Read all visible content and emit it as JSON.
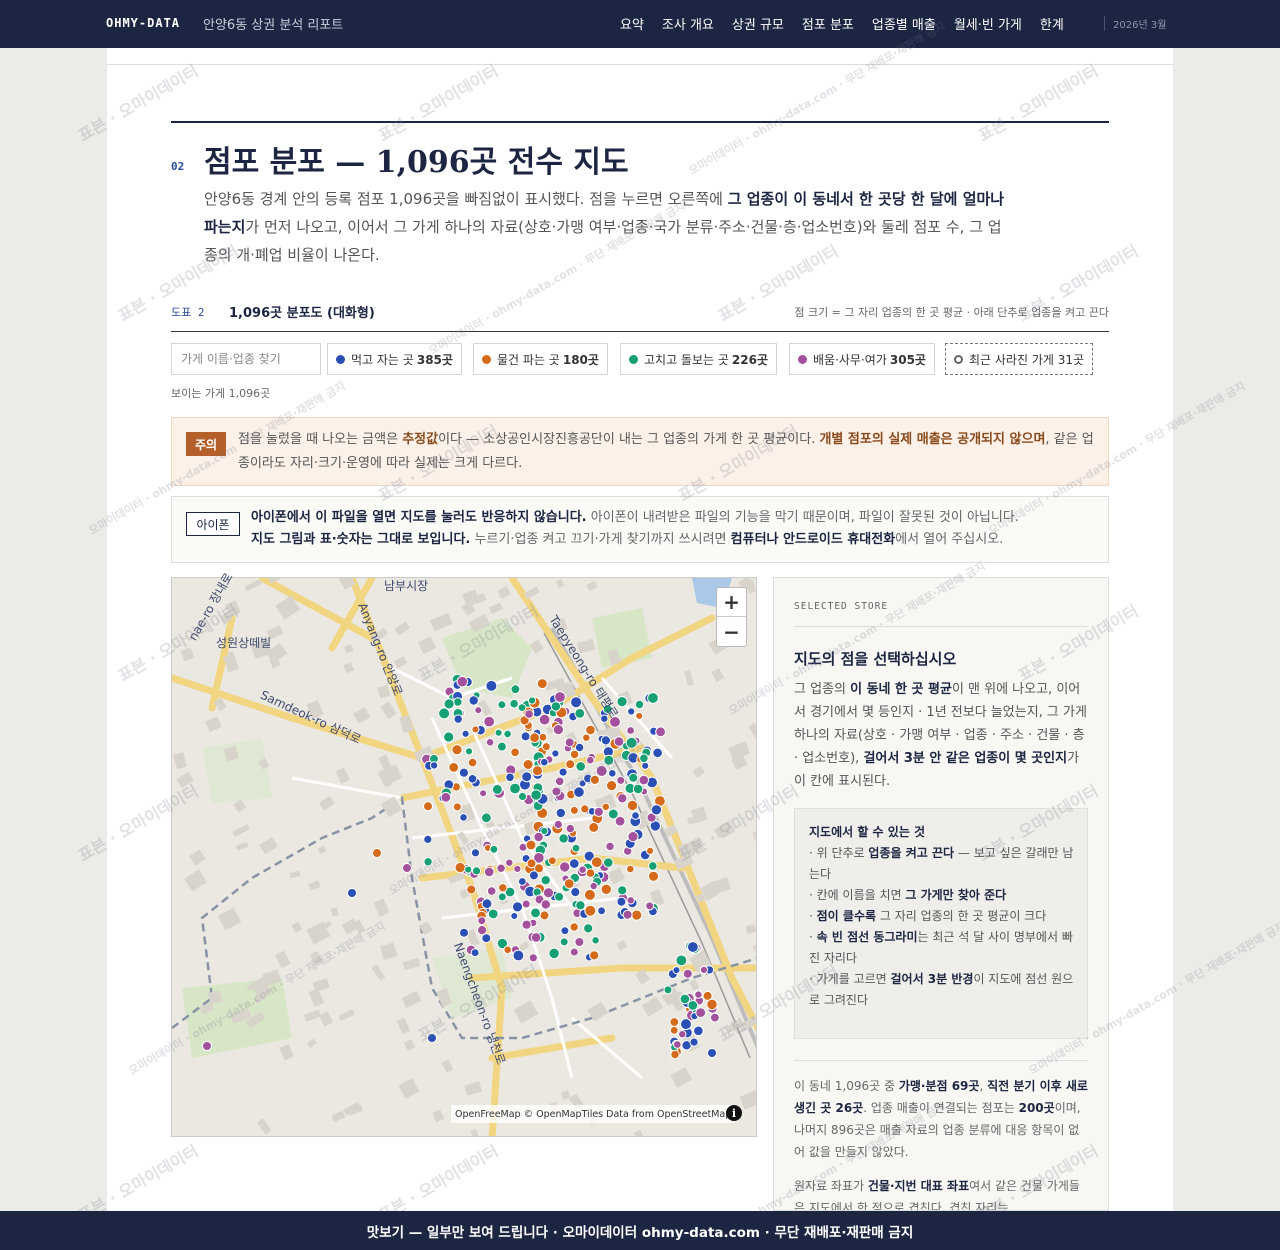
{
  "nav": {
    "brand": "OHMY-DATA",
    "subtitle": "안양6동 상권 분석 리포트",
    "links": [
      "요약",
      "조사 개요",
      "상권 규모",
      "점포 분포",
      "업종별 매출",
      "월세·빈 가게",
      "한계"
    ],
    "date": "2026년 3월"
  },
  "section": {
    "number": "02",
    "title": "점포 분포 — 1,096곳 전수 지도",
    "desc_1": "안양6동 경계 안의 등록 점포 1,096곳을 빠짐없이 표시했다. 점을 누르면 오른쪽에 ",
    "desc_bold": "그 업종이 이 동네서 한 곳당 한 달에 얼마나 파는지",
    "desc_2": "가 먼저 나오고, 이어서 그 가게 하나의 자료(상호·가맹 여부·업종·국가 분류·주소·건물·층·업소번호)와 둘레 점포 수, 그 업종의 개·폐업 비율이 나온다."
  },
  "figure": {
    "tag": "도표 2",
    "title": "1,096곳 분포도 (대화형)",
    "note": "점 크기 = 그 자리 업종의 한 곳 평균 · 아래 단추로 업종을 켜고 끈다"
  },
  "filters": {
    "search_placeholder": "가게 이름·업종 찾기",
    "chips": [
      {
        "label": "먹고 자는 곳",
        "count": "385곳",
        "color": "#2a4fb5"
      },
      {
        "label": "물건 파는 곳",
        "count": "180곳",
        "color": "#d46a1a"
      },
      {
        "label": "고치고 돌보는 곳",
        "count": "226곳",
        "color": "#16a073"
      },
      {
        "label": "배움·사무·여가",
        "count": "305곳",
        "color": "#a3509d"
      }
    ],
    "closed_chip": {
      "label": "최근 사라진 가게",
      "count": "31곳"
    },
    "visible_count": "보이는 가게 1,096곳"
  },
  "caution": {
    "badge": "주의",
    "text_1": "점을 눌렀을 때 나오는 금액은 ",
    "bold_1": "추정값",
    "text_2": "이다 — 소상공인시장진흥공단이 내는 그 업종의 가게 한 곳 평균이다. ",
    "bold_2": "개별 점포의 실제 매출은 공개되지 않으며",
    "text_3": ", 같은 업종이라도 자리·크기·운영에 따라 실제는 크게 다르다."
  },
  "iphone": {
    "badge": "아이폰",
    "bold_1": "아이폰에서 이 파일을 열면 지도를 눌러도 반응하지 않습니다.",
    "text_1": " 아이폰이 내려받은 파일의 기능을 막기 때문이며, 파일이 잘못된 것이 아닙니다.",
    "bold_2": "지도 그림과 표·숫자는 그대로 보입니다.",
    "text_2": " 누르기·업종 켜고 끄기·가게 찾기까지 쓰시려면 ",
    "bold_3": "컴퓨터나 안드로이드 휴대전화",
    "text_3": "에서 열어 주십시오."
  },
  "map": {
    "zoom_in": "+",
    "zoom_out": "−",
    "attribution": "OpenFreeMap © OpenMapTiles Data from OpenStreetMap",
    "info": "i",
    "labels": {
      "market": "남부시장",
      "villa": "성원상떼빌",
      "samdeok": "Samdeok-ro 삼덕로",
      "anyang": "Anyang-ro 안양로",
      "taepyeong": "Taepyeong-ro 태평로",
      "namgyeong": "Naengcheon-ro 냉천로",
      "jangnae": "nae-ro 장내로"
    }
  },
  "panel": {
    "kicker": "SELECTED STORE",
    "title": "지도의 점을 선택하십시오",
    "desc_1": "그 업종의 ",
    "desc_b1": "이 동네 한 곳 평균",
    "desc_2": "이 맨 위에 나오고, 이어서 경기에서 몇 등인지 · 1년 전보다 늘었는지, 그 가게 하나의 자료(상호 · 가맹 여부 · 업종 · 주소 · 건물 · 층 · 업소번호), ",
    "desc_b2": "걸어서 3분 안 같은 업종이 몇 곳인지",
    "desc_3": "가 이 칸에 표시된다.",
    "howto_title": "지도에서 할 수 있는 것",
    "howto": [
      {
        "pre": "· 위 단추로 ",
        "bold": "업종을 켜고 끈다",
        "post": " — 보고 싶은 갈래만 남는다"
      },
      {
        "pre": "· 칸에 이름을 치면 ",
        "bold": "그 가게만 찾아 준다",
        "post": ""
      },
      {
        "pre": "· ",
        "bold": "점이 클수록",
        "post": " 그 자리 업종의 한 곳 평균이 크다"
      },
      {
        "pre": "· ",
        "bold": "속 빈 점선 동그라미",
        "post": "는 최근 석 달 사이 명부에서 빠진 자리다"
      },
      {
        "pre": "· 가게를 고르면 ",
        "bold": "걸어서 3분 반경",
        "post": "이 지도에 점선 원으로 그려진다"
      }
    ],
    "stats_1": "이 동네 1,096곳 중 ",
    "stats_b1": "가맹·분점 69곳",
    "stats_2": ", ",
    "stats_b2": "직전 분기 이후 새로 생긴 곳 26곳",
    "stats_3": ". 업종 매출이 연결되는 점포는 ",
    "stats_b3": "200곳",
    "stats_4": "이며, 나머지 896곳은 매출 자료의 업종 분류에 대응 항목이 없어 값을 만들지 않았다.",
    "note_1": "원자료 좌표가 ",
    "note_b1": "건물·지번 대표 좌표",
    "note_2": "여서 같은 건물 가게들은 지도에서 한 점으로 겹친다. 겹친 자리는"
  },
  "watermark": "표본 · 오마이데이터",
  "watermark_2": "오마이데이터 · ohmy-data.com · 무단 재배포·재판매 금지",
  "footer": "맛보기 — 일부만 보여 드립니다 · 오마이데이터 ohmy-data.com · 무단 재배포·재판매 금지",
  "colors": {
    "navy": "#1c2541",
    "food": "#2a4fb5",
    "retail": "#d46a1a",
    "service": "#16a073",
    "office": "#a3509d",
    "caution": "#b5602b"
  }
}
